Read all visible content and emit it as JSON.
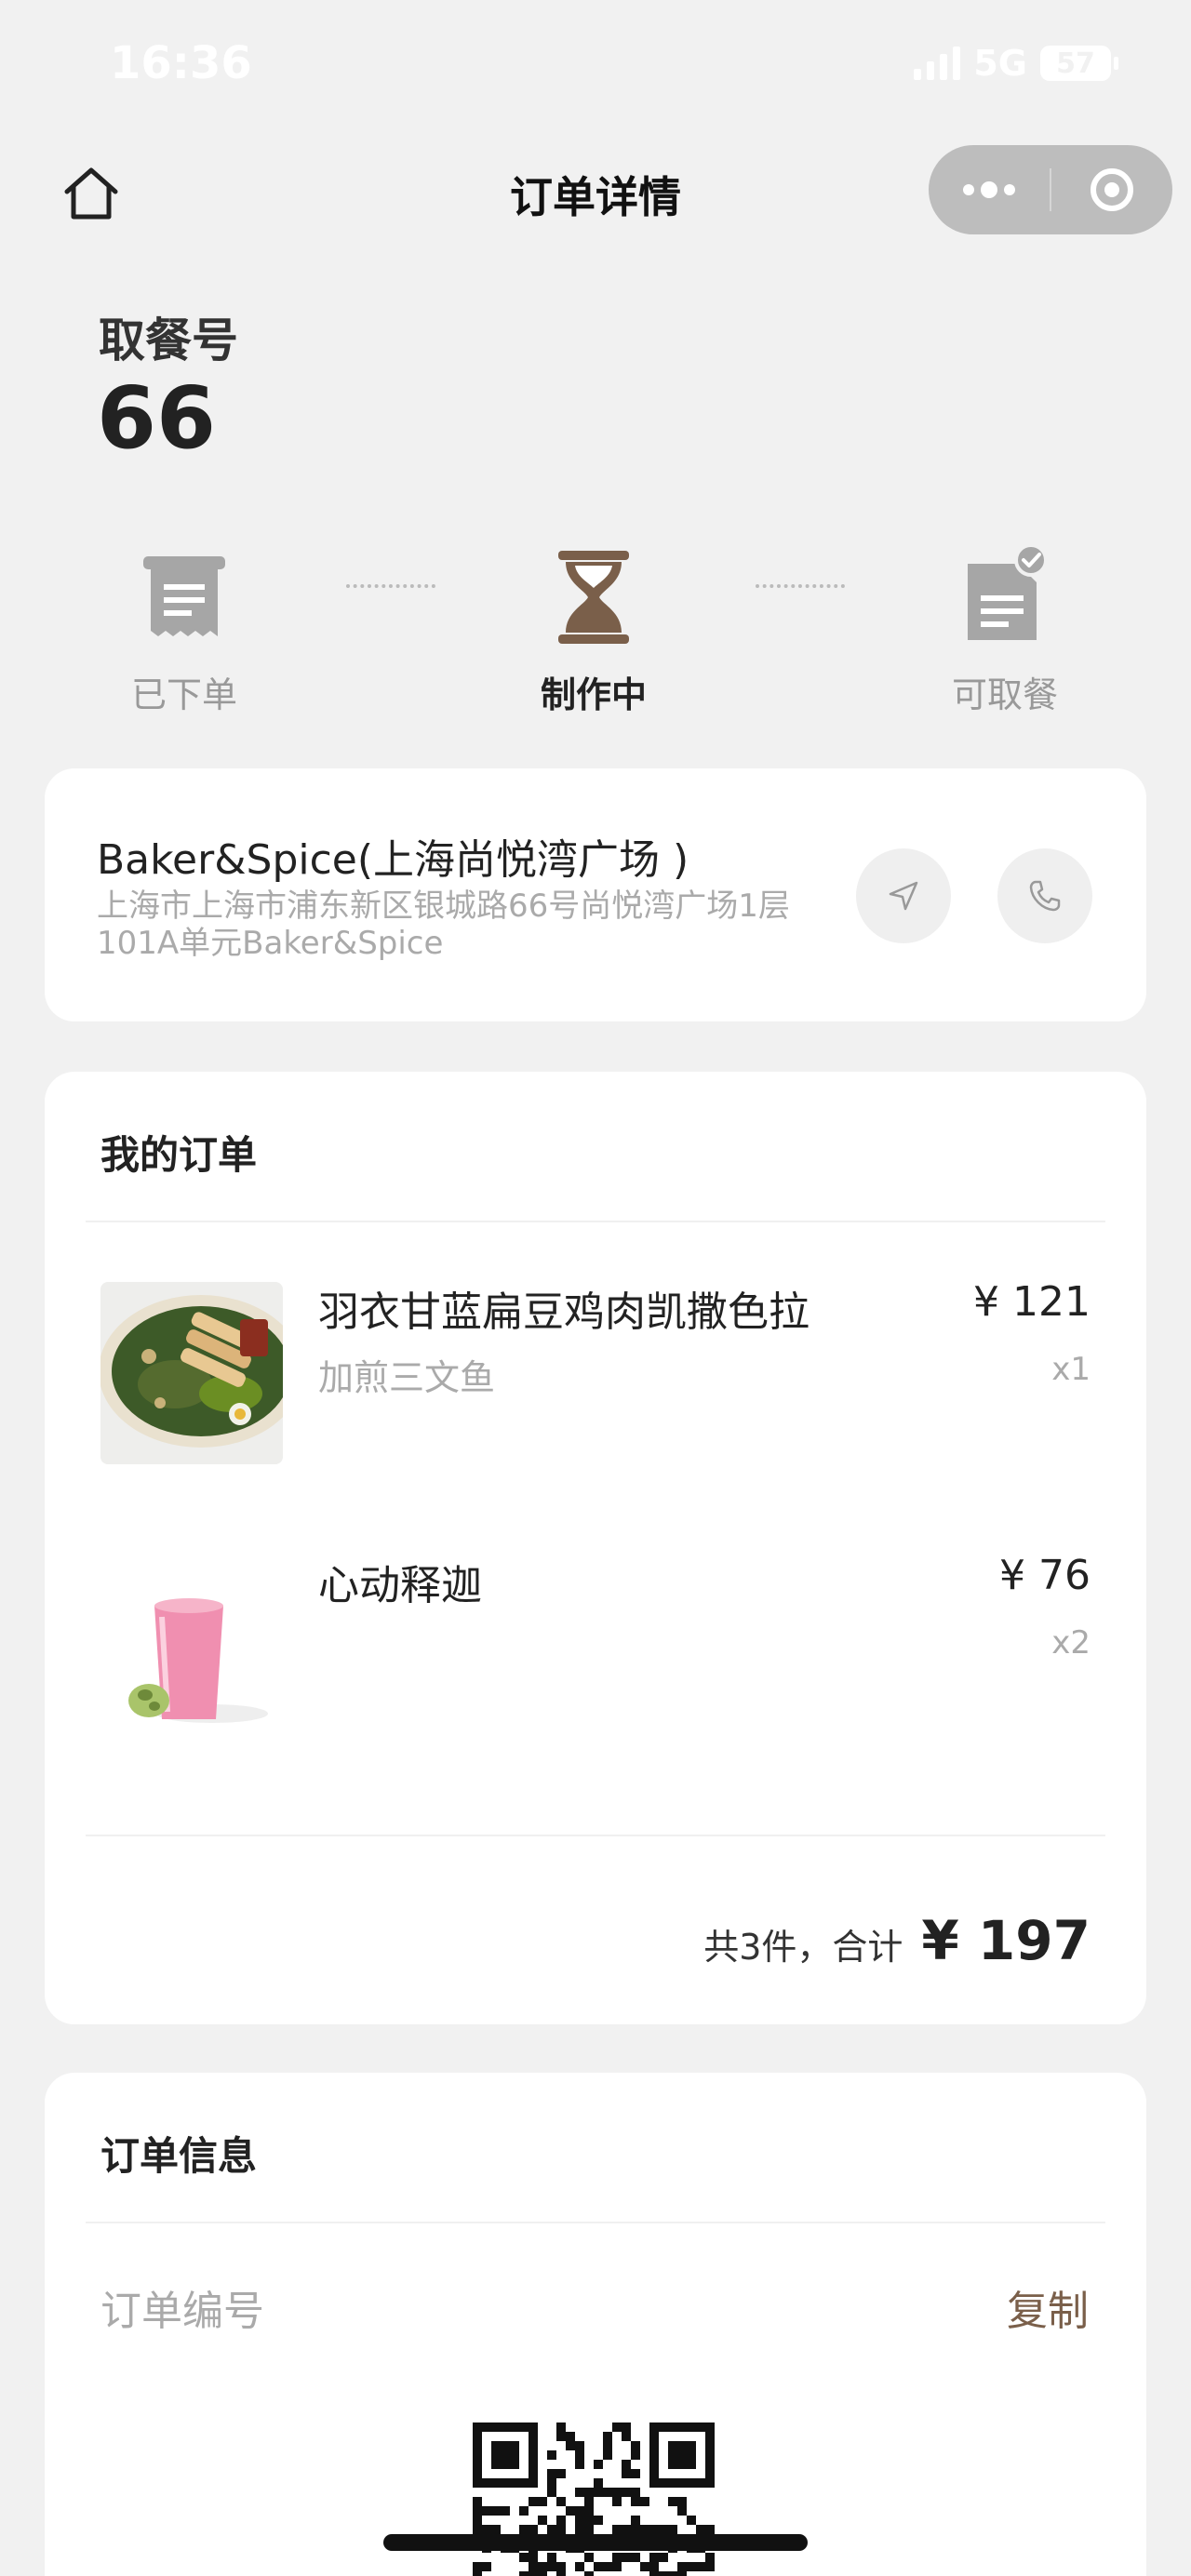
{
  "status_bar": {
    "time": "16:36",
    "network": "5G",
    "battery": "57"
  },
  "nav": {
    "title": "订单详情"
  },
  "pickup": {
    "label": "取餐号",
    "number": "66"
  },
  "progress": {
    "steps": [
      {
        "label": "已下单",
        "icon": "receipt-icon",
        "state": "done"
      },
      {
        "label": "制作中",
        "icon": "hourglass-icon",
        "state": "active"
      },
      {
        "label": "可取餐",
        "icon": "document-check-icon",
        "state": "pending"
      }
    ]
  },
  "store": {
    "name": "Baker&Spice(上海尚悦湾广场 )",
    "address": "上海市上海市浦东新区银城路66号尚悦湾广场1层101A单元Baker&Spice"
  },
  "order": {
    "title": "我的订单",
    "items": [
      {
        "name": "羽衣甘蓝扁豆鸡肉凯撒色拉",
        "spec": "加煎三文鱼",
        "price": "¥ 121",
        "qty": "x1",
        "image": "salad-image"
      },
      {
        "name": "心动释迦",
        "spec": "",
        "price": "¥ 76",
        "qty": "x2",
        "image": "pink-smoothie-image"
      }
    ],
    "summary_label": "共3件，合计",
    "total": "¥ 197"
  },
  "order_info": {
    "title": "订单信息",
    "number_label": "订单编号",
    "copy_label": "复制"
  },
  "colors": {
    "background": "#f1f1f1",
    "card": "#ffffff",
    "brand_brown": "#7a5f4a",
    "icon_grey": "#a6a6a6",
    "muted_text": "#aaaaaa"
  }
}
